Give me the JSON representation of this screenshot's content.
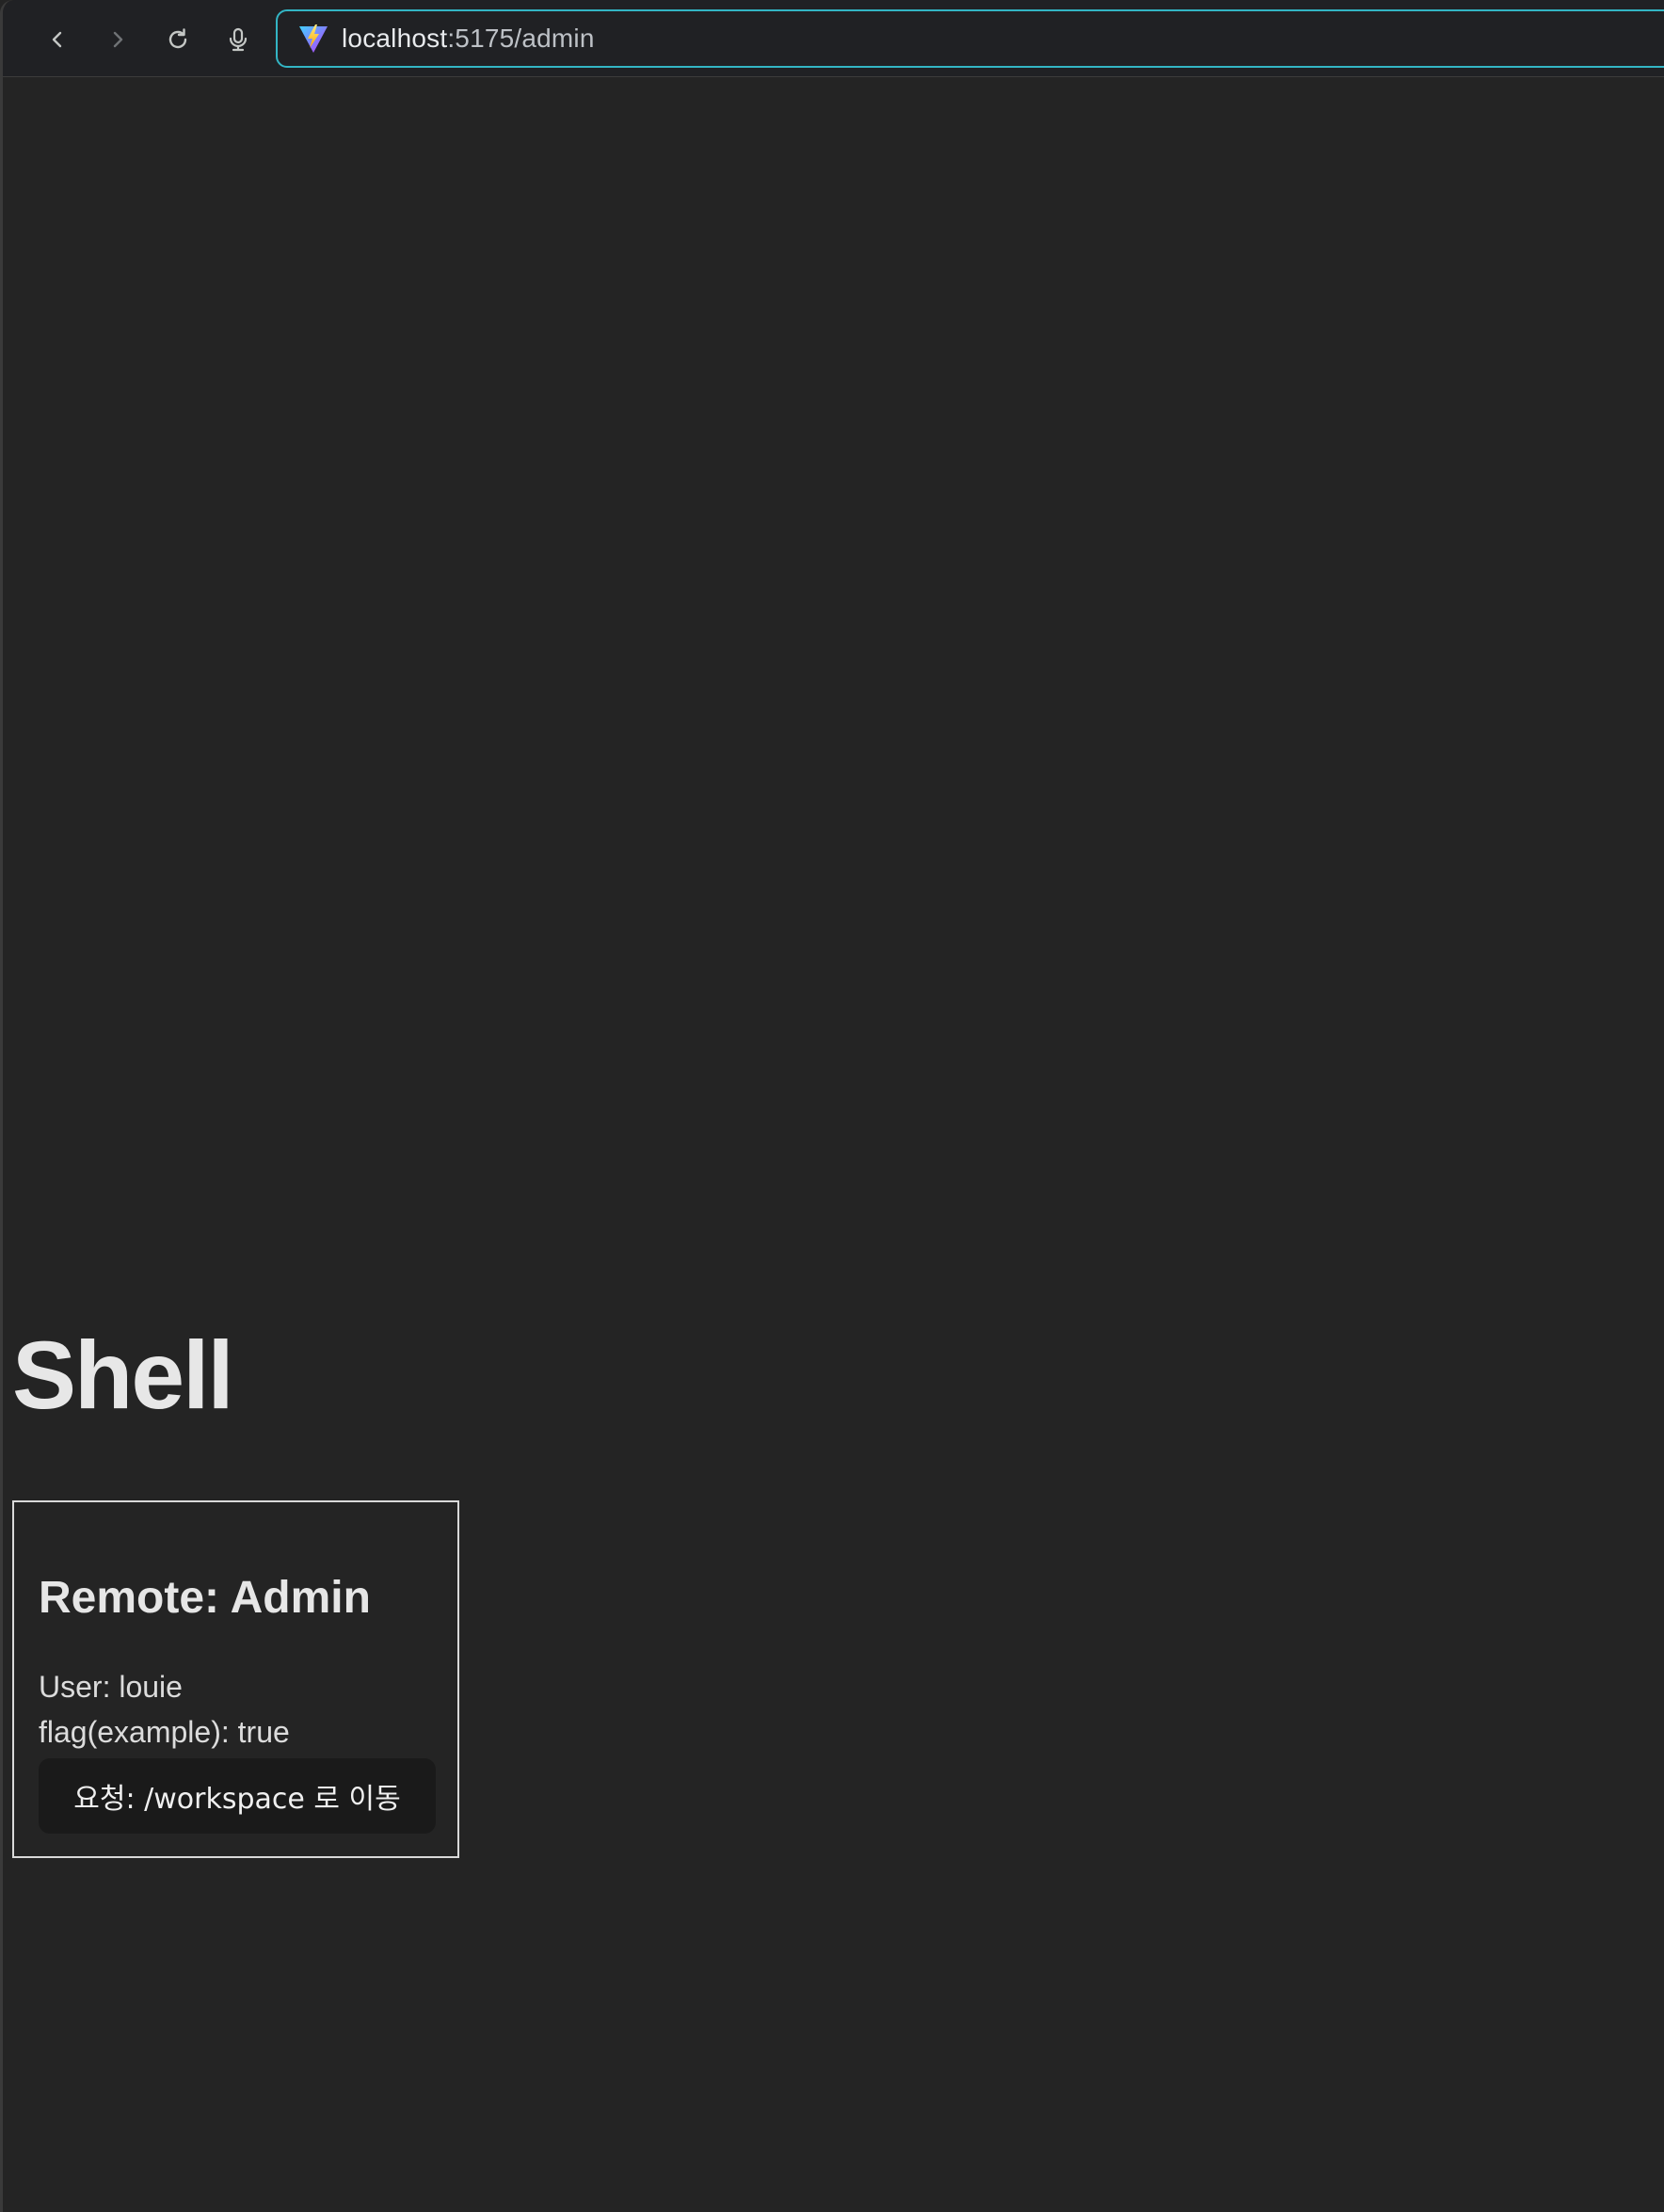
{
  "browser": {
    "url_host": "localhost",
    "url_path": ":5175/admin",
    "icons": {
      "back": "chevron-left-icon",
      "forward": "chevron-right-icon",
      "reload": "reload-icon",
      "voice": "microphone-icon",
      "site": "vite-logo-icon"
    },
    "accent_color": "#33b5c4"
  },
  "page": {
    "title": "Shell",
    "background_color": "#242424",
    "remote": {
      "title": "Remote: Admin",
      "user_line": "User: louie",
      "flag_line": "flag(example): true",
      "button_label": "요청: /workspace 로 이동"
    }
  }
}
